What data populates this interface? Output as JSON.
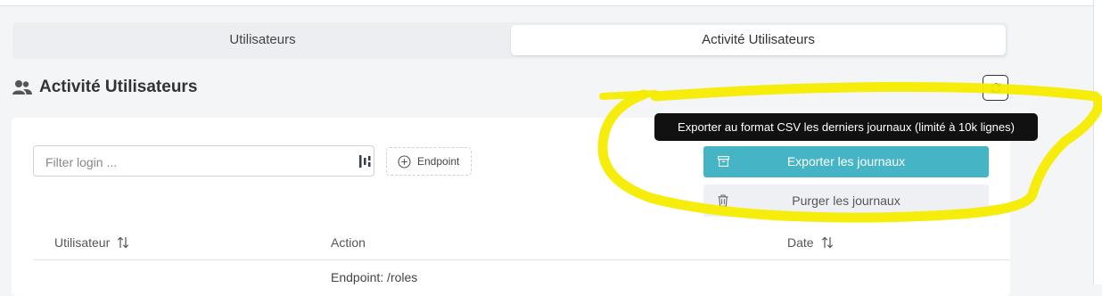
{
  "tabs": [
    {
      "label": "Utilisateurs",
      "active": false
    },
    {
      "label": "Activité Utilisateurs",
      "active": true
    }
  ],
  "section": {
    "title": "Activité Utilisateurs",
    "icon": "users-icon"
  },
  "toolbar": {
    "refresh_icon": "refresh-icon",
    "filter_placeholder": "Filter login ...",
    "filter_value": "",
    "endpoint_label": "Endpoint",
    "tooltip": "Exporter au format CSV les derniers journaux (limité à 10k lignes)",
    "export_label": "Exporter les journaux",
    "purge_label": "Purger les journaux"
  },
  "table": {
    "columns": [
      {
        "label": "Utilisateur",
        "sortable": true
      },
      {
        "label": "Action",
        "sortable": false
      },
      {
        "label": "Date",
        "sortable": true
      }
    ],
    "rows": [
      {
        "utilisateur": "",
        "action": "Endpoint: /roles",
        "date": ""
      }
    ]
  },
  "colors": {
    "accent": "#45b5c5",
    "highlight_marker": "#f5ec00",
    "tooltip_bg": "#111111"
  }
}
